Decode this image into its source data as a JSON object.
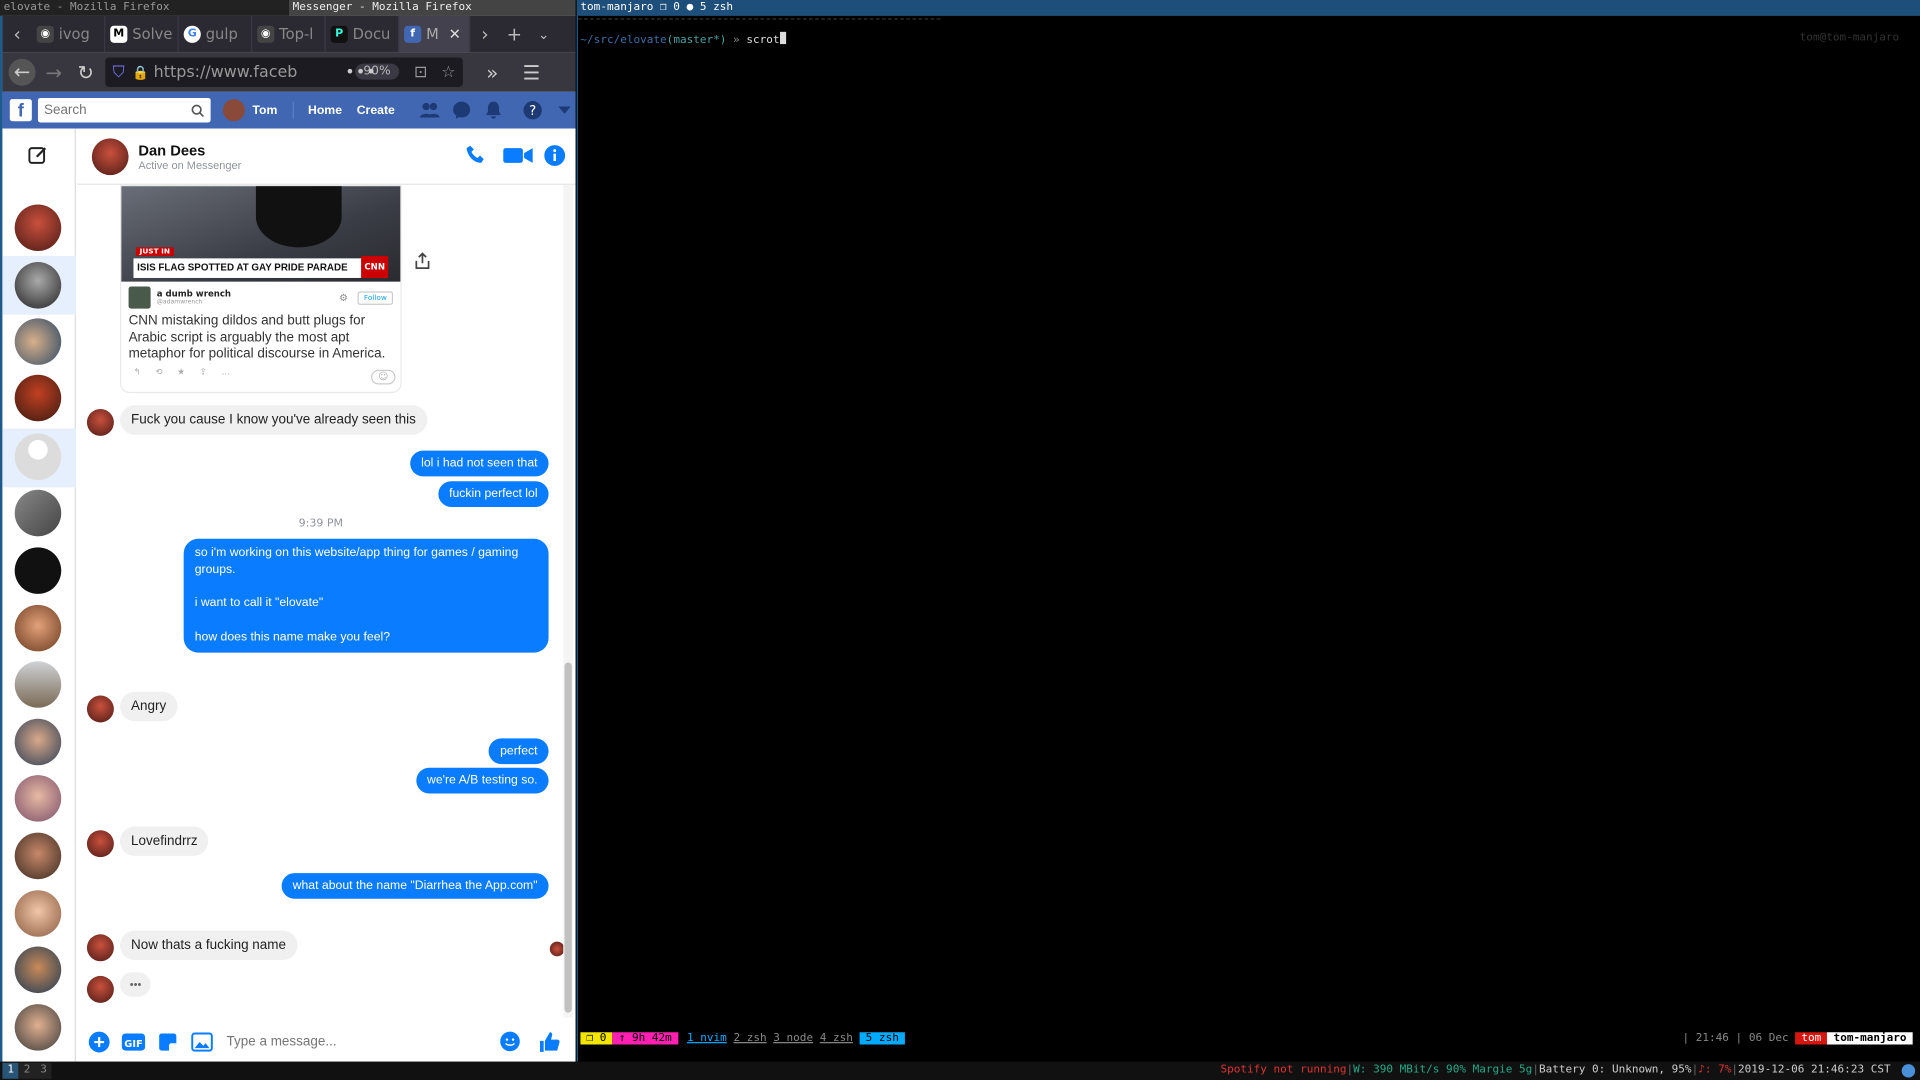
{
  "wm": {
    "left_title": "elovate - Mozilla Firefox",
    "mid_title": "Messenger - Mozilla Firefox",
    "right_title": "tom-manjaro ❒ 0 ● 5 zsh"
  },
  "browser": {
    "tabs": [
      {
        "label": "ivog",
        "icon": "github-icon"
      },
      {
        "label": "Solve",
        "icon": "medium-icon"
      },
      {
        "label": "gulp",
        "icon": "google-icon"
      },
      {
        "label": "Top-l",
        "icon": "github-icon"
      },
      {
        "label": "Docu",
        "icon": "docs-icon"
      },
      {
        "label": "M",
        "icon": "facebook-icon"
      }
    ],
    "url": "https://www.faceb",
    "zoom": "90%"
  },
  "facebook": {
    "search_placeholder": "Search",
    "user": "Tom",
    "home": "Home",
    "create": "Create"
  },
  "chat": {
    "contact_name": "Dan Dees",
    "contact_status": "Active on Messenger",
    "shared_image": {
      "banner_tag": "JUST IN",
      "headline": "ISIS FLAG SPOTTED AT GAY PRIDE PARADE",
      "network": "CNN",
      "tweet_author": "a dumb wrench",
      "tweet_handle": "@adamwrench",
      "follow": "Follow",
      "tweet_text": "CNN mistaking dildos and butt plugs for Arabic script is arguably the most apt metaphor for political discourse in America."
    },
    "messages": [
      {
        "from": "them",
        "text": "Fuck you cause I know you've already seen this"
      },
      {
        "from": "me",
        "text": "lol i had not seen that"
      },
      {
        "from": "me",
        "text": "fuckin perfect lol"
      },
      {
        "from": "time",
        "text": "9:39 PM"
      },
      {
        "from": "me",
        "lines": [
          "so i'm working on this website/app thing for games / gaming",
          "groups.",
          "",
          "i want to call it \"elovate\"",
          "",
          "how does this name make you feel?"
        ]
      },
      {
        "from": "them",
        "text": "Angry"
      },
      {
        "from": "me",
        "text": "perfect"
      },
      {
        "from": "me",
        "text": "we're A/B testing so."
      },
      {
        "from": "them",
        "text": "Lovefindrrz"
      },
      {
        "from": "me",
        "text": "what about the name \"Diarrhea the App.com\""
      },
      {
        "from": "them",
        "text": "Now thats a fucking name"
      },
      {
        "from": "them",
        "text": "•••"
      }
    ],
    "composer_placeholder": "Type a message..."
  },
  "terminal": {
    "prompt_path": "~/src/elovate",
    "prompt_branch": "(master*)",
    "prompt_sym": "»",
    "command": "scrot",
    "right_prompt": "tom@tom-manjaro",
    "tmux": {
      "session": "❒ 0",
      "uptime": "↑ 9h 42m",
      "windows": [
        "1 nvim",
        "2 zsh",
        "3 node",
        "4 zsh"
      ],
      "active_window": "5 zsh",
      "time": "21:46",
      "date": "06 Dec",
      "user": "tom",
      "host": "tom-manjaro"
    }
  },
  "statusbar": {
    "workspaces": [
      "1",
      "2",
      "3"
    ],
    "spotify": "Spotify not running",
    "wifi": "W: 390 MBit/s 90% Margie 5g",
    "battery": "Battery 0: Unknown, 95%",
    "volume": "♪: 7%",
    "datetime": "2019-12-06 21:46:23 CST"
  },
  "colors": {
    "fb_blue": "#4267b2",
    "messenger_blue": "#0a7cff",
    "tmux_yellow": "#f2e600",
    "tmux_pink": "#ff1fb1",
    "tmux_blue": "#00aaff"
  }
}
